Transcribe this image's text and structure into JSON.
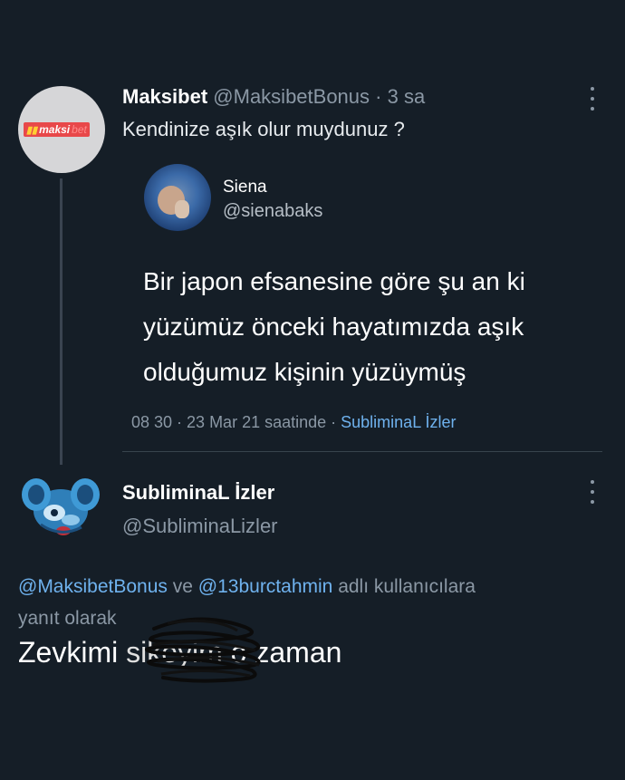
{
  "tweet": {
    "name": "Maksibet",
    "handle": "@MaksibetBonus",
    "separator": "·",
    "time": "3 sa",
    "text": "Kendinize aşık olur muydunuz ?",
    "avatar_logo_text": "maksi",
    "avatar_logo_text2": "bet"
  },
  "quoted": {
    "name": "Siena",
    "handle": "@sienabaks",
    "text": "Bir japon efsanesine göre şu an ki yüzümüz önceki hayatımızda aşık olduğumuz kişinin yüzüymüş",
    "meta_time": "08 30 · 23 Mar 21 saatinde ·",
    "meta_source": "SubliminaL İzler"
  },
  "reply": {
    "name": "SubliminaL İzler",
    "handle": "@SubliminaLizler",
    "mention1": "@MaksibetBonus",
    "connector": "ve",
    "mention2": "@13burctahmin",
    "reply_suffix": "adlı kullanıcılara",
    "reply_suffix2": "yanıt olarak",
    "text_before": "Zevkimi",
    "text_censored": "sikeyim",
    "text_after": "o zaman"
  },
  "colors": {
    "background": "#151e27",
    "link": "#6fb2ee",
    "muted": "#8b98a5"
  },
  "icons": [
    "more-options-icon"
  ]
}
